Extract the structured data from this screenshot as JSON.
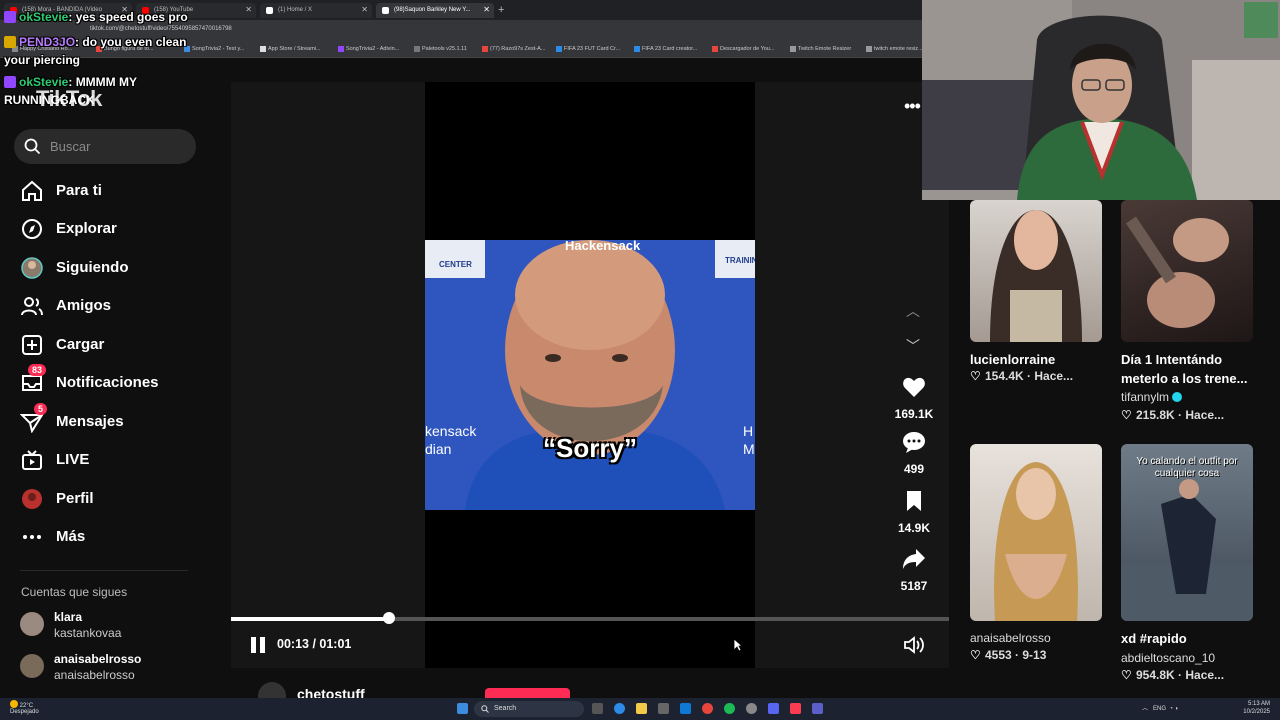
{
  "browser": {
    "tabs": [
      {
        "label": "(158) Mora - BANDIDA (Video",
        "color": "#ff0000"
      },
      {
        "label": "(158) YouTube",
        "color": "#ff0000"
      },
      {
        "label": "(1) Home / X",
        "color": "#ffffff"
      },
      {
        "label": "(98)Saquon Barkley New Y...",
        "color": "#ffffff"
      }
    ],
    "url": "tiktok.com/@chetostuff/video/7554095857470016798",
    "bookmarks": [
      "Happy Cristiano Ro...",
      "Bungo figura de to...",
      "SongTrivia2 - Test y...",
      "App Store / Streami...",
      "SongTrivia2 - Adivin...",
      "Paletools v25.1.11",
      "(77) Razo97s Zest-A...",
      "FIFA 23 FUT Card Cr...",
      "FIFA 23 Card creator...",
      "Descargador de You...",
      "Twitch Emote Resizer",
      "twitch emote resiz..."
    ]
  },
  "chat": [
    {
      "user": "okStevie",
      "text": ": yes speed goes pro"
    },
    {
      "user": "PEND3JO",
      "text": ": do you even clean",
      "cont": "your piercing"
    },
    {
      "user": "okStevie",
      "text": ": MMMM MY",
      "cont": "RUNNINGBACK"
    }
  ],
  "tiktok": {
    "logo": "TikTok",
    "search_placeholder": "Buscar",
    "nav": [
      {
        "label": "Para ti",
        "icon": "home-icon"
      },
      {
        "label": "Explorar",
        "icon": "compass-icon"
      },
      {
        "label": "Siguiendo",
        "icon": "following-avatar-icon"
      },
      {
        "label": "Amigos",
        "icon": "friends-icon"
      },
      {
        "label": "Cargar",
        "icon": "upload-icon"
      },
      {
        "label": "Notificaciones",
        "icon": "inbox-icon",
        "badge": "83"
      },
      {
        "label": "Mensajes",
        "icon": "send-icon",
        "badge": "5"
      },
      {
        "label": "LIVE",
        "icon": "live-tv-icon"
      },
      {
        "label": "Perfil",
        "icon": "profile-icon"
      },
      {
        "label": "Más",
        "icon": "more-dots-icon"
      }
    ],
    "following_title": "Cuentas que sigues",
    "following": [
      {
        "name": "klara",
        "handle": "kastankovaa"
      },
      {
        "name": "anaisabelrosso",
        "handle": "anaisabelrosso"
      }
    ]
  },
  "video": {
    "caption": "“Sorry”",
    "backdrop_top": "Hackensack",
    "backdrop_left": "kensack",
    "backdrop_left2": "dian",
    "backdrop_right": "H",
    "backdrop_right2": "M",
    "sign_left": "CENTER",
    "sign_right": "TRAININ",
    "likes": "169.1K",
    "comments": "499",
    "saves": "14.9K",
    "shares": "5187",
    "time": "00:13 / 01:01",
    "progress": 0.22,
    "author": "chetostuff"
  },
  "grid": [
    {
      "title": "lucienlorraine",
      "stats": "154.4K · Hace...",
      "user": ""
    },
    {
      "title": "Día 1 Intentándo meterlo a los trene...",
      "user": "tifannylm",
      "stats": "215.8K · Hace..."
    },
    {
      "title": "anaisabelrosso",
      "stats": "4553 · 9-13",
      "user": ""
    },
    {
      "title": "xd #rapido",
      "user": "abdieltoscano_10",
      "stats": "954.8K · Hace...",
      "overlay": "Yo calando el outfit por cualquier cosa"
    }
  ],
  "taskbar": {
    "weather_temp": "22°C",
    "weather_desc": "Despejado",
    "search": "Search",
    "lang": "ENG",
    "time": "5:13 AM",
    "date": "10/2/2025"
  },
  "colors": {
    "accent": "#fe2c55",
    "chat_user": "#2ecc71",
    "twitch": "#9146ff"
  }
}
